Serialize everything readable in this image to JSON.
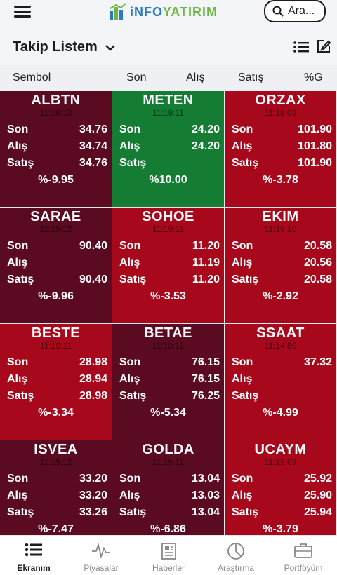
{
  "header": {
    "logo_text_a": "iNFO",
    "logo_text_b": "YATIRIM",
    "search_label": "Ara...",
    "brand_blue": "#2c7ac0",
    "brand_green": "#6cb644"
  },
  "watchlist": {
    "title": "Takip Listem"
  },
  "columns": {
    "symbol": "Sembol",
    "last": "Son",
    "bid": "Alış",
    "ask": "Satış",
    "change": "%G"
  },
  "row_labels": {
    "last": "Son",
    "bid": "Alış",
    "ask": "Satış"
  },
  "tiles": [
    {
      "symbol": "ALBTN",
      "time": "11:19:13",
      "last": "34.76",
      "bid": "34.74",
      "ask": "34.76",
      "change": "%-9.95",
      "color": "dark"
    },
    {
      "symbol": "METEN",
      "time": "11:19:11",
      "last": "24.20",
      "bid": "24.20",
      "ask": "",
      "change": "%10.00",
      "color": "green"
    },
    {
      "symbol": "ORZAX",
      "time": "11:19:09",
      "last": "101.90",
      "bid": "101.80",
      "ask": "101.90",
      "change": "%-3.78",
      "color": "red"
    },
    {
      "symbol": "SARAE",
      "time": "11:19:12",
      "last": "90.40",
      "bid": "",
      "ask": "90.40",
      "change": "%-9.96",
      "color": "dark"
    },
    {
      "symbol": "SOHOE",
      "time": "11:19:11",
      "last": "11.20",
      "bid": "11.19",
      "ask": "11.20",
      "change": "%-3.53",
      "color": "red"
    },
    {
      "symbol": "EKIM",
      "time": "11:19:10",
      "last": "20.58",
      "bid": "20.56",
      "ask": "20.58",
      "change": "%-2.92",
      "color": "red"
    },
    {
      "symbol": "BESTE",
      "time": "11:19:11",
      "last": "28.98",
      "bid": "28.94",
      "ask": "28.98",
      "change": "%-3.34",
      "color": "red"
    },
    {
      "symbol": "BETAE",
      "time": "11:19:12",
      "last": "76.15",
      "bid": "76.15",
      "ask": "76.25",
      "change": "%-5.34",
      "color": "dark"
    },
    {
      "symbol": "SSAAT",
      "time": "11:14:50",
      "last": "37.32",
      "bid": "",
      "ask": "",
      "change": "%-4.99",
      "color": "red"
    },
    {
      "symbol": "ISVEA",
      "time": "11:19:12",
      "last": "33.20",
      "bid": "33.20",
      "ask": "33.26",
      "change": "%-7.47",
      "color": "dark"
    },
    {
      "symbol": "GOLDA",
      "time": "11:19:12",
      "last": "13.04",
      "bid": "13.03",
      "ask": "13.04",
      "change": "%-6.86",
      "color": "dark"
    },
    {
      "symbol": "UCAYM",
      "time": "11:19:09",
      "last": "25.92",
      "bid": "25.90",
      "ask": "25.94",
      "change": "%-3.79",
      "color": "red"
    }
  ],
  "nav": [
    {
      "label": "Ekranım",
      "icon": "list-icon",
      "active": true
    },
    {
      "label": "Piyasalar",
      "icon": "pulse-icon",
      "active": false
    },
    {
      "label": "Haberler",
      "icon": "newspaper-icon",
      "active": false
    },
    {
      "label": "Araştırma",
      "icon": "pie-chart-icon",
      "active": false
    },
    {
      "label": "Portföyüm",
      "icon": "briefcase-icon",
      "active": false
    }
  ],
  "colors": {
    "dark": "#5a0b22",
    "red": "#a8081c",
    "green": "#147d33"
  }
}
